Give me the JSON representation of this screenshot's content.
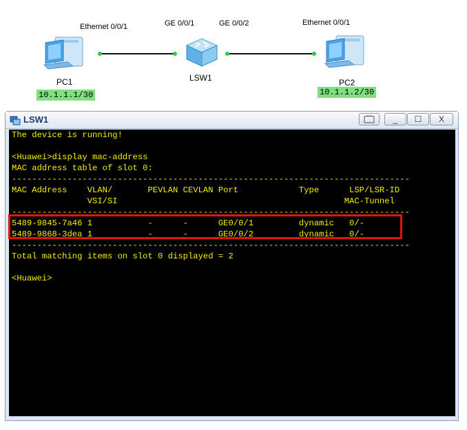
{
  "topology": {
    "pc1": {
      "label": "PC1",
      "ip": "10.1.1.1/30",
      "port": "Ethernet 0/0/1"
    },
    "pc2": {
      "label": "PC2",
      "ip": "10.1.1.2/30",
      "port": "Ethernet 0/0/1"
    },
    "switch": {
      "label": "LSW1",
      "port_left": "GE 0/0/1",
      "port_right": "GE 0/0/2"
    }
  },
  "window": {
    "title": "LSW1",
    "buttons": {
      "minimize": "_",
      "maximize": "☐",
      "close": "X"
    }
  },
  "terminal": {
    "lines": [
      "The device is running!",
      "",
      "<Huawei>display mac-address",
      "MAC address table of slot 0:",
      "-------------------------------------------------------------------------------",
      "MAC Address    VLAN/       PEVLAN CEVLAN Port            Type      LSP/LSR-ID",
      "               VSI/SI                                             MAC-Tunnel",
      "-------------------------------------------------------------------------------",
      "5489-9845-7a46 1           -      -      GE0/0/1         dynamic   0/-",
      "5489-9868-3dea 1           -      -      GE0/0/2         dynamic   0/-",
      "-------------------------------------------------------------------------------",
      "Total matching items on slot 0 displayed = 2",
      "",
      "<Huawei>"
    ]
  },
  "colors": {
    "terminal_text": "#f2f000",
    "highlight": "#e2150e",
    "link_dot": "#2ecc40"
  }
}
